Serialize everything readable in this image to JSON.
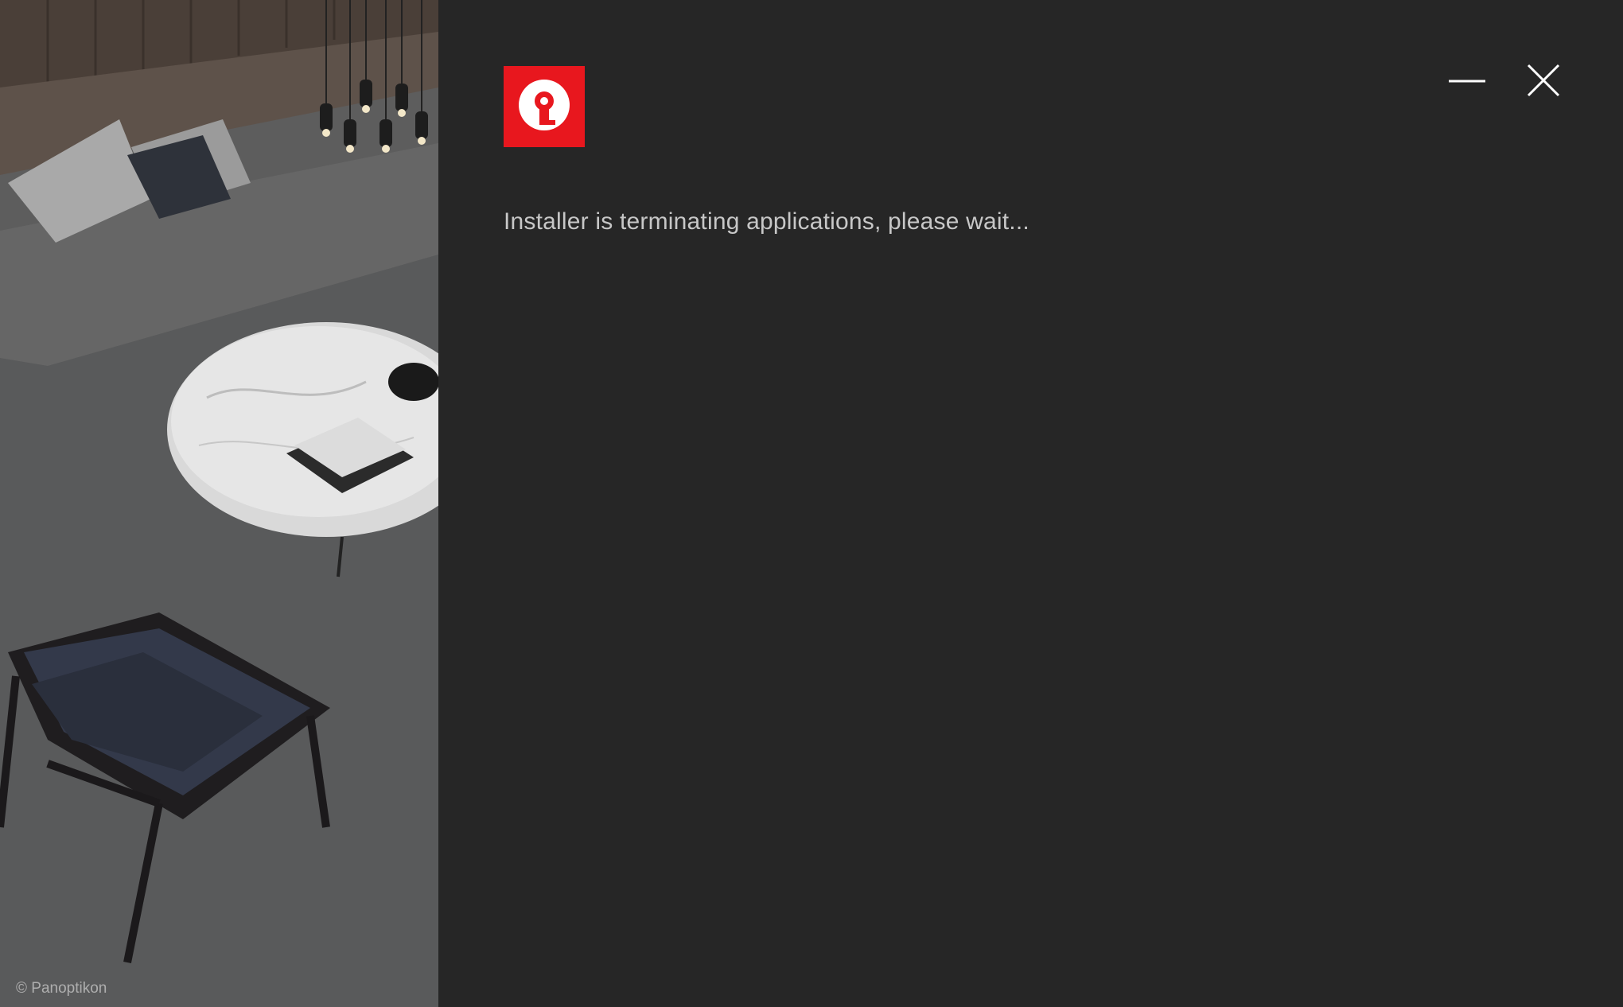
{
  "window": {
    "status_message": "Installer is terminating applications, please wait...",
    "image_credit": "© Panoptikon",
    "accent_color": "#e8171e",
    "background_color": "#262626",
    "text_color": "#c7c7c7"
  },
  "controls": {
    "minimize_icon": "minimize-icon",
    "close_icon": "close-icon"
  },
  "logo": {
    "icon": "keyhole-logo-icon"
  }
}
